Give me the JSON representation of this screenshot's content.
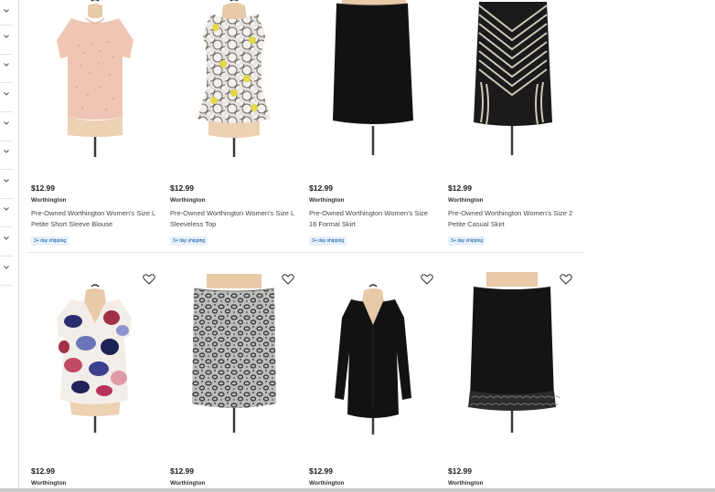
{
  "filters": {
    "rows": [
      {
        "icon": "chevron-down-icon"
      },
      {
        "icon": "chevron-down-icon"
      },
      {
        "icon": "chevron-down-icon"
      },
      {
        "icon": "chevron-down-icon"
      },
      {
        "icon": "chevron-down-icon"
      },
      {
        "icon": "chevron-down-icon"
      },
      {
        "icon": "chevron-down-icon"
      },
      {
        "icon": "chevron-down-icon"
      },
      {
        "icon": "chevron-down-icon"
      },
      {
        "icon": "chevron-down-icon"
      }
    ]
  },
  "products": [
    {
      "price": "$12.99",
      "brand": "Worthington",
      "title": "Pre-Owned Worthington Women's Size L Petite Short Sleeve Blouse",
      "shipping": "3+ day shipping",
      "image": "pink-blouse",
      "favorite_icon": "heart-outline-icon"
    },
    {
      "price": "$12.99",
      "brand": "Worthington",
      "title": "Pre-Owned Worthington Women's Size L Sleeveless Top",
      "shipping": "3+ day shipping",
      "image": "hexagon-print-top",
      "favorite_icon": "heart-outline-icon"
    },
    {
      "price": "$12.99",
      "brand": "Worthington",
      "title": "Pre-Owned Worthington Women's Size 16 Formal Skirt",
      "shipping": "3+ day shipping",
      "image": "black-pencil-skirt",
      "favorite_icon": "heart-outline-icon"
    },
    {
      "price": "$12.99",
      "brand": "Worthington",
      "title": "Pre-Owned Worthington Women's Size 2 Petite Casual Skirt",
      "shipping": "3+ day shipping",
      "image": "chevron-print-skirt",
      "favorite_icon": "heart-outline-icon"
    },
    {
      "price": "$12.99",
      "brand": "Worthington",
      "title": "",
      "shipping": "",
      "image": "floral-print-top",
      "favorite_icon": "heart-outline-icon"
    },
    {
      "price": "$12.99",
      "brand": "Worthington",
      "title": "",
      "shipping": "",
      "image": "leopard-print-skirt",
      "favorite_icon": "heart-outline-icon"
    },
    {
      "price": "$12.99",
      "brand": "Worthington",
      "title": "",
      "shipping": "",
      "image": "black-v-neck-top",
      "favorite_icon": "heart-outline-icon"
    },
    {
      "price": "$12.99",
      "brand": "Worthington",
      "title": "",
      "shipping": "",
      "image": "black-lace-skirt",
      "favorite_icon": "heart-outline-icon"
    }
  ],
  "colors": {
    "badge_bg": "#e6f1fc",
    "badge_text": "#004f9a",
    "divider": "#e3e4e5"
  }
}
